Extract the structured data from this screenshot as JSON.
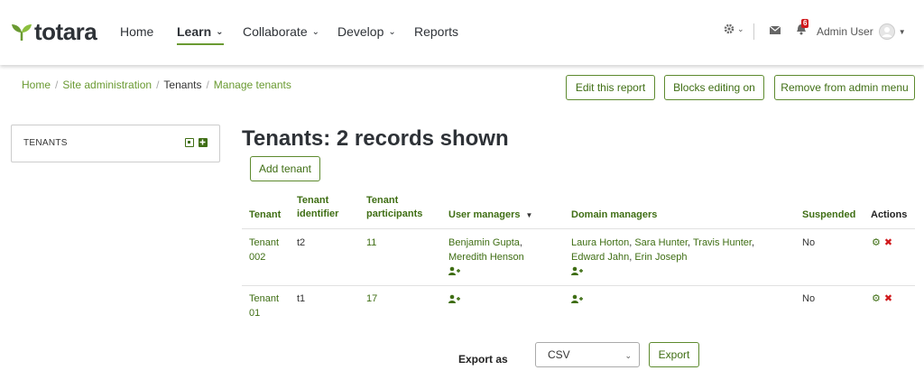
{
  "brand": {
    "name": "totara",
    "accent": "#6a9a32"
  },
  "nav": [
    {
      "label": "Home",
      "dropdown": false,
      "active": false
    },
    {
      "label": "Learn",
      "dropdown": true,
      "active": true
    },
    {
      "label": "Collaborate",
      "dropdown": true,
      "active": false
    },
    {
      "label": "Develop",
      "dropdown": true,
      "active": false
    },
    {
      "label": "Reports",
      "dropdown": false,
      "active": false
    }
  ],
  "header": {
    "notification_count": "6",
    "user_name": "Admin User",
    "icons": [
      "gear-icon",
      "envelope-icon",
      "bell-icon",
      "user-avatar-icon"
    ]
  },
  "breadcrumb": [
    "Home",
    "Site administration",
    "Tenants",
    "Manage tenants"
  ],
  "page_buttons": {
    "edit_report": "Edit this report",
    "blocks_editing": "Blocks editing on",
    "remove_admin_menu": "Remove from admin menu"
  },
  "block": {
    "title": "TENANTS"
  },
  "page": {
    "title": "Tenants: 2 records shown",
    "add_tenant": "Add tenant"
  },
  "table": {
    "headers": {
      "tenant": "Tenant",
      "identifier": "Tenant identifier",
      "participants": "Tenant participants",
      "user_managers": "User managers",
      "domain_managers": "Domain managers",
      "suspended": "Suspended",
      "actions": "Actions"
    },
    "rows": [
      {
        "tenant": "Tenant 002",
        "identifier": "t2",
        "participants": "11",
        "user_managers": [
          "Benjamin Gupta",
          "Meredith Henson"
        ],
        "domain_managers": [
          "Laura Horton",
          "Sara Hunter",
          "Travis Hunter",
          "Edward Jahn",
          "Erin Joseph"
        ],
        "suspended": "No"
      },
      {
        "tenant": "Tenant 01",
        "identifier": "t1",
        "participants": "17",
        "user_managers": [],
        "domain_managers": [],
        "suspended": "No"
      }
    ]
  },
  "export": {
    "label": "Export as",
    "format": "CSV",
    "button": "Export"
  }
}
